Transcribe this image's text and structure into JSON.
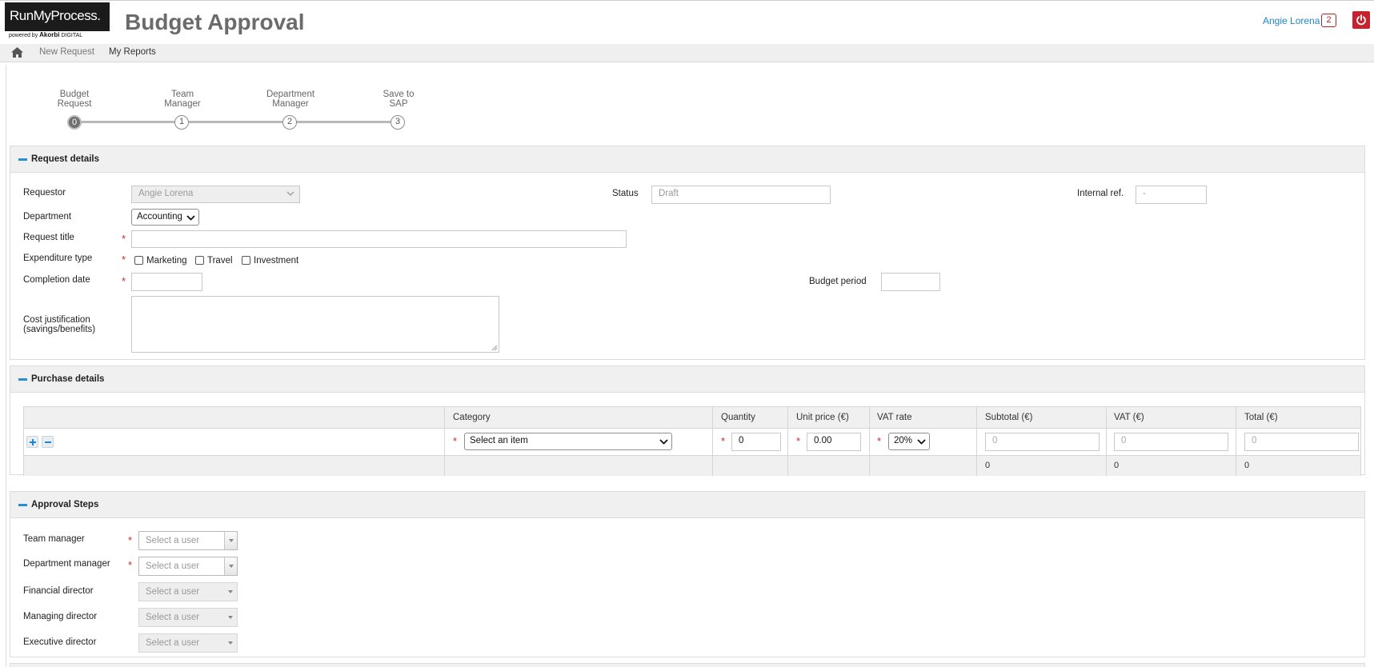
{
  "header": {
    "logo_text": "RunMyProcess.",
    "logo_powered": "powered by",
    "logo_brand": "Akorbi",
    "logo_digital": "DIGITAL",
    "title": "Budget Approval",
    "user_name": "Angie Lorena",
    "notification_count": "2"
  },
  "nav": {
    "new_request": "New Request",
    "my_reports": "My Reports"
  },
  "steps": [
    {
      "line1": "Budget",
      "line2": "Request",
      "num": "0"
    },
    {
      "line1": "Team",
      "line2": "Manager",
      "num": "1"
    },
    {
      "line1": "Department",
      "line2": "Manager",
      "num": "2"
    },
    {
      "line1": "Save to",
      "line2": "SAP",
      "num": "3"
    }
  ],
  "request_details": {
    "title": "Request details",
    "requestor_label": "Requestor",
    "requestor_value": "Angie Lorena",
    "status_label": "Status",
    "status_value": "Draft",
    "internal_ref_label": "Internal ref.",
    "internal_ref_value": "-",
    "department_label": "Department",
    "department_value": "Accounting",
    "request_title_label": "Request title",
    "expenditure_label": "Expenditure type",
    "exp_marketing": "Marketing",
    "exp_travel": "Travel",
    "exp_investment": "Investment",
    "completion_label": "Completion date",
    "budget_period_label": "Budget period",
    "cost_label_1": "Cost justification",
    "cost_label_2": "(savings/benefits)"
  },
  "purchase_details": {
    "title": "Purchase details",
    "columns": {
      "category": "Category",
      "quantity": "Quantity",
      "unit_price": "Unit price (€)",
      "vat_rate": "VAT rate",
      "subtotal": "Subtotal (€)",
      "vat": "VAT (€)",
      "total": "Total (€)"
    },
    "row": {
      "category": "Select an item",
      "quantity": "0",
      "unit_price": "0.00",
      "vat_rate": "20%",
      "subtotal_placeholder": "0",
      "vat_placeholder": "0",
      "total_placeholder": "0"
    },
    "footer": {
      "subtotal": "0",
      "vat": "0",
      "total": "0"
    }
  },
  "approval": {
    "title": "Approval Steps",
    "placeholder": "Select a user",
    "team_manager": "Team manager",
    "department_manager": "Department manager",
    "financial_director": "Financial director",
    "managing_director": "Managing director",
    "executive_director": "Executive director"
  },
  "colors": {
    "accent": "#1d87c8",
    "required": "#d12a2a",
    "power": "#c4232f"
  }
}
